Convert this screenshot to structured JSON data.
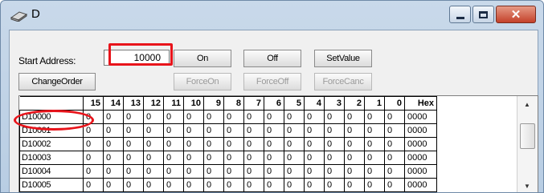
{
  "window": {
    "title": "D",
    "icon": "device-icon",
    "controls": {
      "minimize": "minimize-icon",
      "maximize": "maximize-icon",
      "close": "✕"
    }
  },
  "toolbar": {
    "start_address_label": "Start Address:",
    "start_address_value": "10000",
    "on_label": "On",
    "off_label": "Off",
    "set_value_label": "SetValue",
    "change_order_label": "ChangeOrder",
    "force_on_label": "ForceOn",
    "force_off_label": "ForceOff",
    "force_cancel_label": "ForceCanc"
  },
  "grid": {
    "columns": [
      "15",
      "14",
      "13",
      "12",
      "11",
      "10",
      "9",
      "8",
      "7",
      "6",
      "5",
      "4",
      "3",
      "2",
      "1",
      "0",
      "Hex"
    ],
    "rows": [
      {
        "label": "D10000",
        "bits": [
          "0",
          "0",
          "0",
          "0",
          "0",
          "0",
          "0",
          "0",
          "0",
          "0",
          "0",
          "0",
          "0",
          "0",
          "0",
          "0"
        ],
        "hex": "0000"
      },
      {
        "label": "D10001",
        "bits": [
          "0",
          "0",
          "0",
          "0",
          "0",
          "0",
          "0",
          "0",
          "0",
          "0",
          "0",
          "0",
          "0",
          "0",
          "0",
          "0"
        ],
        "hex": "0000"
      },
      {
        "label": "D10002",
        "bits": [
          "0",
          "0",
          "0",
          "0",
          "0",
          "0",
          "0",
          "0",
          "0",
          "0",
          "0",
          "0",
          "0",
          "0",
          "0",
          "0"
        ],
        "hex": "0000"
      },
      {
        "label": "D10003",
        "bits": [
          "0",
          "0",
          "0",
          "0",
          "0",
          "0",
          "0",
          "0",
          "0",
          "0",
          "0",
          "0",
          "0",
          "0",
          "0",
          "0"
        ],
        "hex": "0000"
      },
      {
        "label": "D10004",
        "bits": [
          "0",
          "0",
          "0",
          "0",
          "0",
          "0",
          "0",
          "0",
          "0",
          "0",
          "0",
          "0",
          "0",
          "0",
          "0",
          "0"
        ],
        "hex": "0000"
      },
      {
        "label": "D10005",
        "bits": [
          "0",
          "0",
          "0",
          "0",
          "0",
          "0",
          "0",
          "0",
          "0",
          "0",
          "0",
          "0",
          "0",
          "0",
          "0",
          "0"
        ],
        "hex": "0000"
      }
    ]
  },
  "annotations": {
    "highlight_color": "#e8141b"
  },
  "colors": {
    "column_separator": "#2a3bdc"
  }
}
